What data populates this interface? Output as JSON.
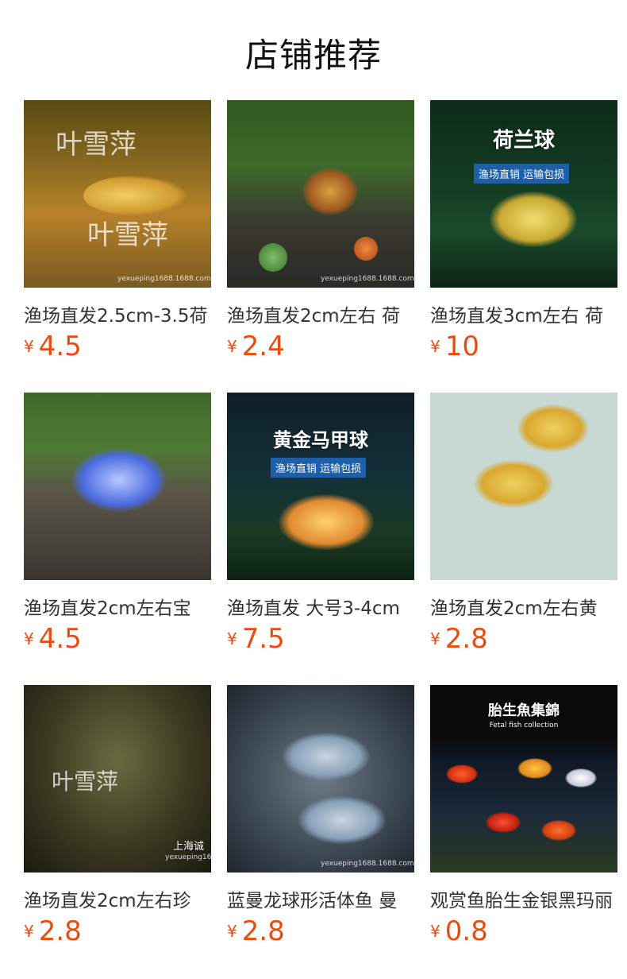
{
  "header": {
    "title": "店铺推荐"
  },
  "products": [
    {
      "name": "渔场直发2.5cm-3.5荷",
      "price": "4.5",
      "currency": "¥",
      "overlay_title": "",
      "banner": "",
      "watermark": "叶雪萍",
      "watermark2": "叶雪萍",
      "url_wm": "yexueping1688.1688.com"
    },
    {
      "name": "渔场直发2cm左右 荷",
      "price": "2.4",
      "currency": "¥",
      "overlay_title": "",
      "banner": "",
      "watermark": "",
      "watermark2": "",
      "url_wm": "yexueping1688.1688.com"
    },
    {
      "name": "渔场直发3cm左右 荷",
      "price": "10",
      "currency": "¥",
      "overlay_title": "荷兰球",
      "banner": "渔场直销 运输包损",
      "watermark": "",
      "watermark2": "",
      "url_wm": ""
    },
    {
      "name": "渔场直发2cm左右宝",
      "price": "4.5",
      "currency": "¥",
      "overlay_title": "",
      "banner": "",
      "watermark": "",
      "watermark2": "",
      "url_wm": ""
    },
    {
      "name": "渔场直发 大号3-4cm",
      "price": "7.5",
      "currency": "¥",
      "overlay_title": "黄金马甲球",
      "banner": "渔场直销 运输包损",
      "watermark": "",
      "watermark2": "",
      "url_wm": ""
    },
    {
      "name": "渔场直发2cm左右黄",
      "price": "2.8",
      "currency": "¥",
      "overlay_title": "",
      "banner": "",
      "watermark": "",
      "watermark2": "",
      "url_wm": ""
    },
    {
      "name": "渔场直发2cm左右珍",
      "price": "2.8",
      "currency": "¥",
      "overlay_title": "",
      "banner": "上海诚",
      "watermark": "叶雪萍",
      "watermark2": "",
      "url_wm": "yexueping16"
    },
    {
      "name": "蓝曼龙球形活体鱼 曼",
      "price": "2.8",
      "currency": "¥",
      "overlay_title": "",
      "banner": "",
      "watermark": "",
      "watermark2": "",
      "url_wm": "yexueping1688.1688.com"
    },
    {
      "name": "观赏鱼胎生金银黑玛丽",
      "price": "0.8",
      "currency": "¥",
      "overlay_title": "胎生魚集錦",
      "banner": "Fetal fish collection",
      "watermark": "",
      "watermark2": "",
      "url_wm": ""
    }
  ]
}
